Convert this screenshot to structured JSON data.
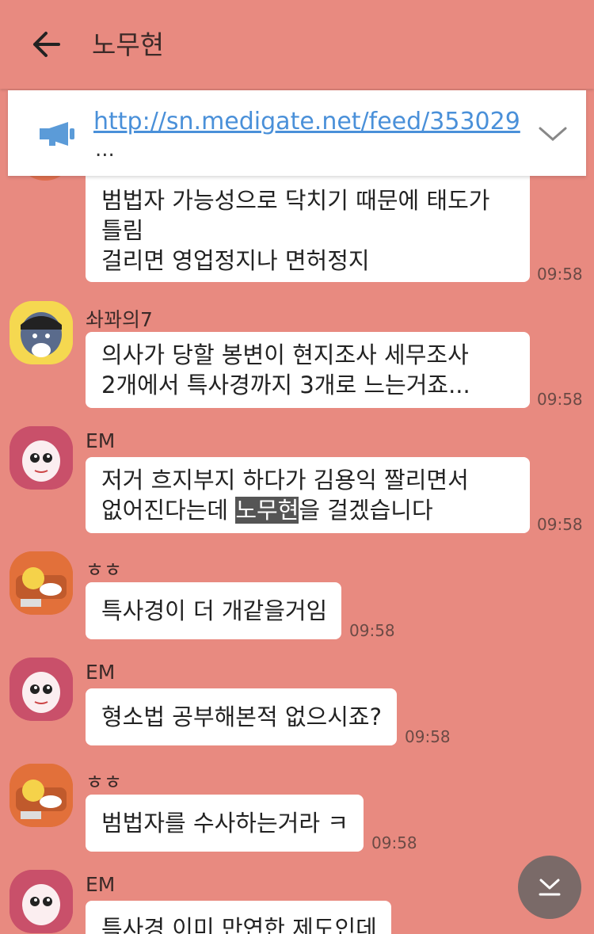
{
  "header": {
    "title": "노무현"
  },
  "notice": {
    "link": "http://sn.medigate.net/feed/353029",
    "more": "..."
  },
  "messages": {
    "m0": {
      "lines": [
        "범법자 가능성으로 닥치기 때문에  태도가",
        "틀림",
        "걸리면 영업정지나 면허정지"
      ],
      "time": "09:58"
    },
    "m1": {
      "sender": "솨꽈의7",
      "lines": [
        "의사가 당할 봉변이 현지조사 세무조사",
        "2개에서 특사경까지 3개로 느는거죠..."
      ],
      "time": "09:58"
    },
    "m2": {
      "sender": "EM",
      "line1": "저거 흐지부지 하다가 김용익 짤리면서",
      "line2_pre": "없어진다는데 ",
      "line2_hl": "노무현",
      "line2_post": "을 걸겠습니다",
      "time": "09:58"
    },
    "m3": {
      "sender": "ㅎㅎ",
      "lines": [
        "특사경이 더 개같을거임"
      ],
      "time": "09:58"
    },
    "m4": {
      "sender": "EM",
      "lines": [
        "형소법 공부해본적 없으시죠?"
      ],
      "time": "09:58"
    },
    "m5": {
      "sender": "ㅎㅎ",
      "lines": [
        "범법자를 수사하는거라 ㅋ"
      ],
      "time": "09:58"
    },
    "m6": {
      "sender": "EM",
      "lines": [
        "특사경 이미 만연한 제도인데"
      ]
    }
  },
  "icons": {
    "back": "arrow-left-icon",
    "notice": "megaphone-icon",
    "expand": "chevron-down-icon",
    "scroll_down": "scroll-to-bottom-icon"
  }
}
